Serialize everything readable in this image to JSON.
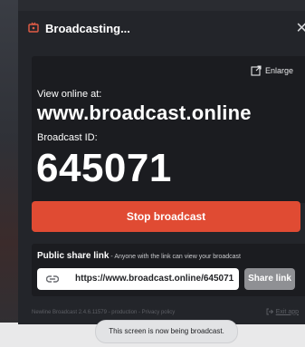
{
  "window": {
    "title": "Broadcasting...",
    "close_label": "✕"
  },
  "main": {
    "enlarge_label": "Enlarge",
    "view_online_label": "View online at:",
    "view_online_url": "www.broadcast.online",
    "broadcast_id_label": "Broadcast ID:",
    "broadcast_id": "645071",
    "stop_button_label": "Stop broadcast"
  },
  "share": {
    "heading": "Public share link",
    "subheading": " - Anyone with the link can view your broadcast",
    "link": "https://www.broadcast.online/645071",
    "button_label": "Share link"
  },
  "footer": {
    "version": "Newline Broadcast 2.4.6.11579 - production - Privacy policy",
    "exit_label": "Exit app"
  },
  "toast": {
    "message": "This screen is now being broadcast."
  },
  "icons": {
    "title": "broadcast-icon",
    "enlarge": "external-link-icon",
    "link": "link-icon",
    "exit": "exit-icon"
  },
  "colors": {
    "accent": "#e04b33",
    "panel": "#23252a",
    "card": "#1b1c20",
    "share_button": "#8f9094"
  }
}
